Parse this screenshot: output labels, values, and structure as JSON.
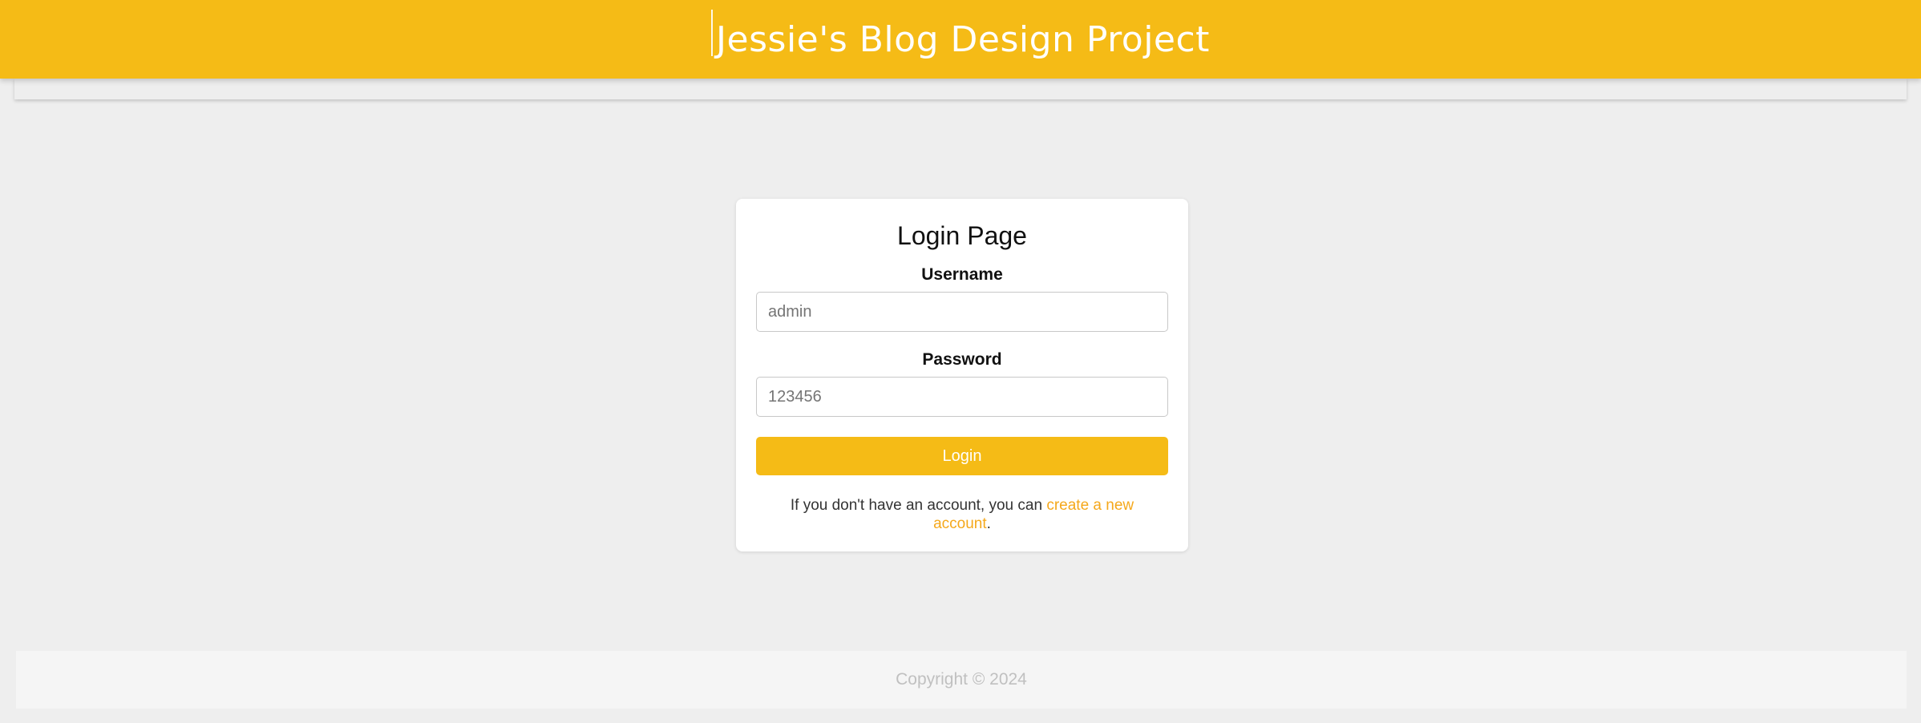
{
  "header": {
    "title": "Jessie's Blog Design Project"
  },
  "login": {
    "title": "Login Page",
    "username_label": "Username",
    "username_placeholder": "admin",
    "password_label": "Password",
    "password_placeholder": "123456",
    "submit_label": "Login",
    "signup_prefix": "If you don't have an account, you can ",
    "signup_link": "create a new account",
    "signup_suffix": "."
  },
  "footer": {
    "copyright": "Copyright © 2024"
  },
  "colors": {
    "accent": "#f5bb16",
    "link": "#f5a81b",
    "background": "#eeeeee"
  }
}
